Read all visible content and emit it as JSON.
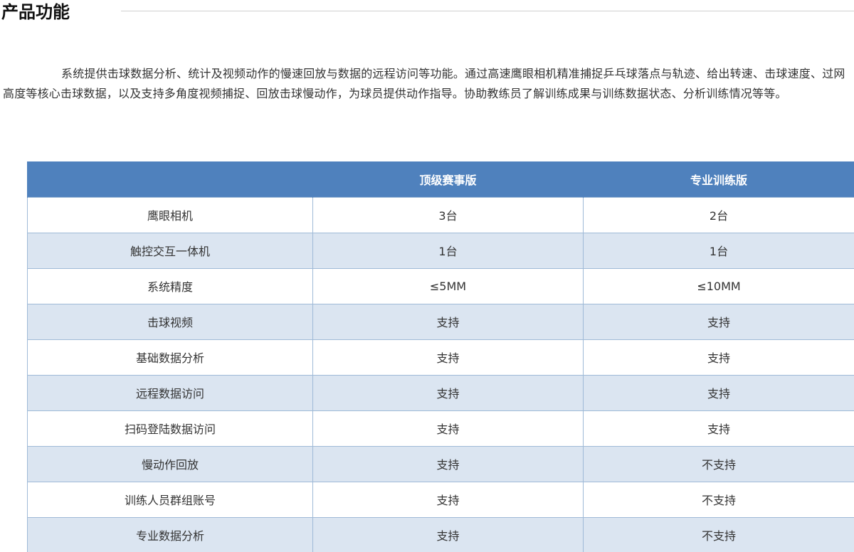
{
  "section": {
    "title": "产品功能"
  },
  "intro": {
    "text": "系统提供击球数据分析、统计及视频动作的慢速回放与数据的远程访问等功能。通过高速鹰眼相机精准捕捉乒乓球落点与轨迹、给出转速、击球速度、过网高度等核心击球数据，以及支持多角度视频捕捉、回放击球慢动作，为球员提供动作指导。协助教练员了解训练成果与训练数据状态、分析训练情况等等。"
  },
  "table": {
    "header": {
      "feature": "",
      "top_edition": "顶级赛事版",
      "pro_edition": "专业训练版"
    },
    "rows": [
      {
        "feature": "鹰眼相机",
        "top": "3台",
        "pro": "2台"
      },
      {
        "feature": "触控交互一体机",
        "top": "1台",
        "pro": "1台"
      },
      {
        "feature": "系统精度",
        "top": "≤5MM",
        "pro": "≤10MM"
      },
      {
        "feature": "击球视频",
        "top": "支持",
        "pro": "支持"
      },
      {
        "feature": "基础数据分析",
        "top": "支持",
        "pro": "支持"
      },
      {
        "feature": "远程数据访问",
        "top": "支持",
        "pro": "支持"
      },
      {
        "feature": "扫码登陆数据访问",
        "top": "支持",
        "pro": "支持"
      },
      {
        "feature": "慢动作回放",
        "top": "支持",
        "pro": "不支持"
      },
      {
        "feature": "训练人员群组账号",
        "top": "支持",
        "pro": "不支持"
      },
      {
        "feature": "专业数据分析",
        "top": "支持",
        "pro": "不支持"
      }
    ]
  },
  "colors": {
    "header_bg": "#4f81bd",
    "row_alt_bg": "#dbe5f1",
    "border": "#9fbad7"
  }
}
